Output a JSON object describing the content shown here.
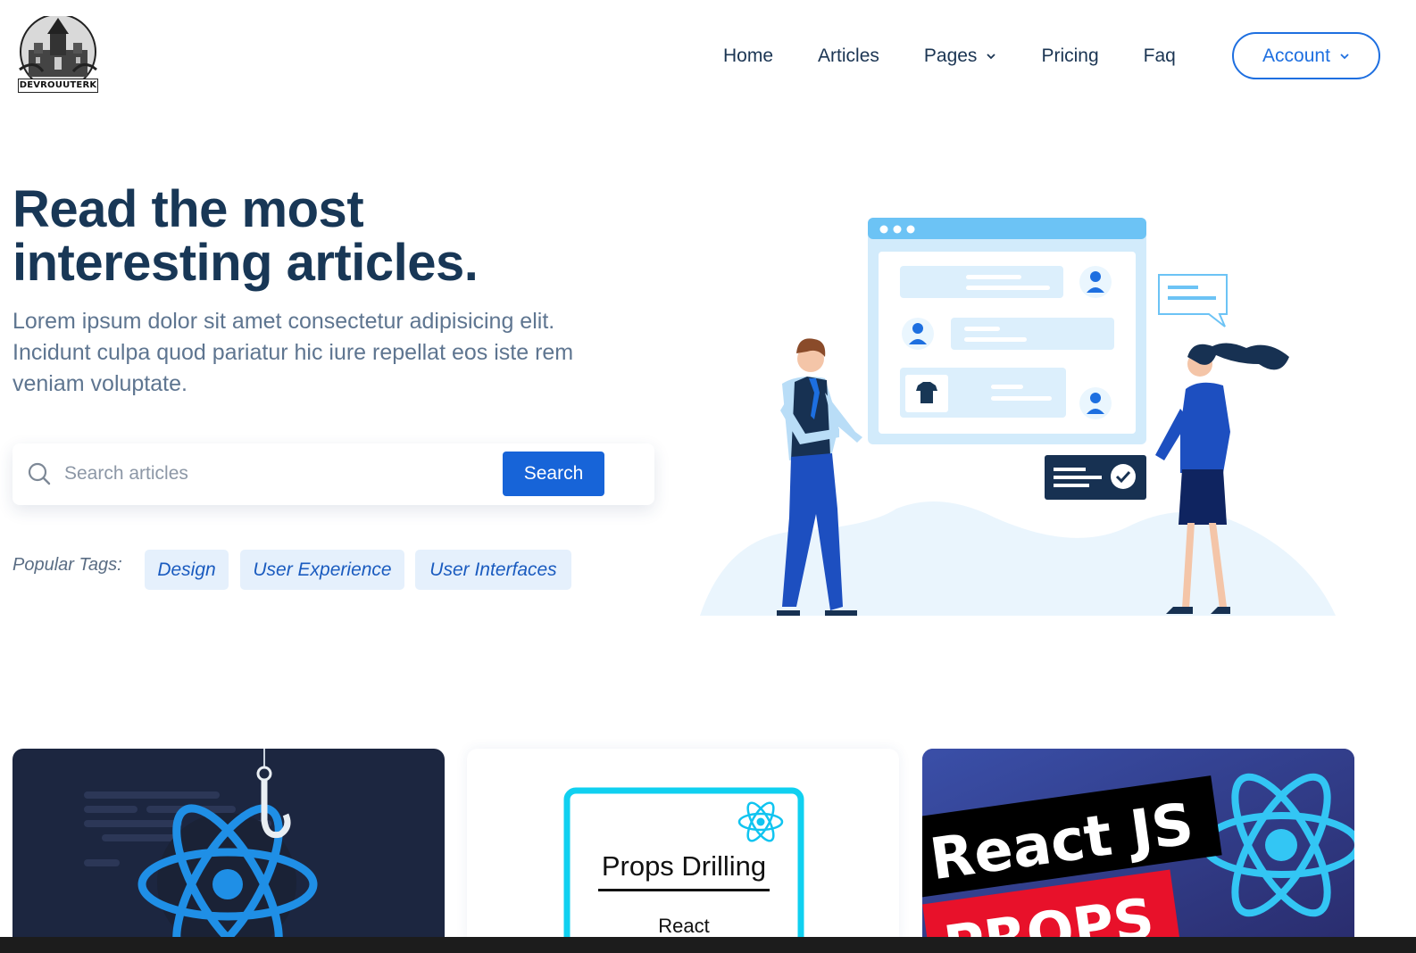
{
  "header": {
    "logo_text": "DEVROUUTERK",
    "nav": [
      {
        "label": "Home"
      },
      {
        "label": "Articles"
      },
      {
        "label": "Pages",
        "dropdown": true
      },
      {
        "label": "Pricing"
      },
      {
        "label": "Faq"
      }
    ],
    "account_label": "Account"
  },
  "hero": {
    "title_line1": "Read the most",
    "title_line2": "interesting articles.",
    "subtitle_line1": "Lorem ipsum dolor sit amet consectetur adipisicing elit.",
    "subtitle_line2": "Incidunt culpa quod pariatur hic iure repellat eos iste rem",
    "subtitle_line3": "veniam voluptate."
  },
  "search": {
    "placeholder": "Search articles",
    "value": "",
    "button_label": "Search"
  },
  "tags": {
    "label": "Popular Tags:",
    "items": [
      "Design",
      "User Experience",
      "User Interfaces"
    ]
  },
  "cards": [
    {
      "image": "react-hook-thumbnail"
    },
    {
      "image": "props-drilling-thumbnail",
      "text_main": "Props Drilling",
      "text_sub": "React"
    },
    {
      "image": "react-js-props-thumbnail",
      "text_main": "React JS",
      "text_sub": "PROPS"
    }
  ],
  "colors": {
    "primary": "#1764d8",
    "heading": "#183756",
    "tag_bg": "#e5f0fc",
    "card1_bg": "#1c2640",
    "card3_bg": "#2c3c8d"
  }
}
